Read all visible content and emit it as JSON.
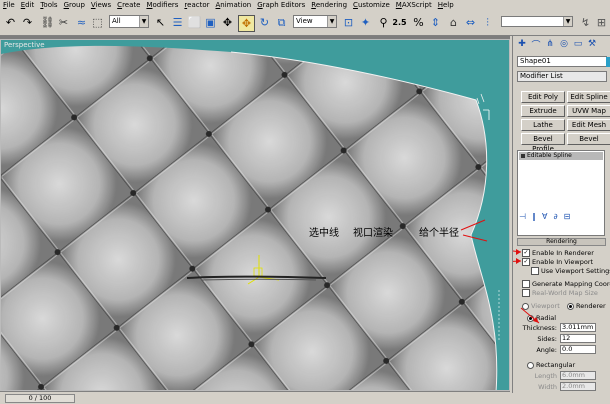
{
  "menu": [
    "File",
    "Edit",
    "Tools",
    "Group",
    "Views",
    "Create",
    "Modifiers",
    "reactor",
    "Animation",
    "Graph Editors",
    "Rendering",
    "Customize",
    "MAXScript",
    "Help"
  ],
  "toolbar": {
    "selection_filter": "All",
    "reference_coord": "View",
    "snap_value": "2.5"
  },
  "viewport": {
    "label": "Perspective",
    "annotations": {
      "a1": "选中线",
      "a2": "视口渲染",
      "a3": "给个半径"
    }
  },
  "panel": {
    "object_name": "Shape01",
    "modifier_list": "Modifier List",
    "buttons": [
      [
        "Edit Poly",
        "Edit Spline"
      ],
      [
        "Extrude",
        "UVW Map"
      ],
      [
        "Lathe",
        "Edit Mesh"
      ],
      [
        "Bevel Profile",
        "Bevel"
      ]
    ],
    "stack_item": "Editable Spline",
    "rendering": {
      "title": "Rendering",
      "enable_in_renderer": "Enable In Renderer",
      "enable_in_viewport": "Enable In Viewport",
      "use_viewport_settings": "Use Viewport Settings",
      "generate_mapping_coords": "Generate Mapping Coords.",
      "real_world_map_size": "Real-World Map Size",
      "viewport_radio": "Viewport",
      "renderer_radio": "Renderer",
      "radial": "Radial",
      "thickness_label": "Thickness:",
      "thickness_value": "3.011mm",
      "sides_label": "Sides:",
      "sides_value": "12",
      "angle_label": "Angle:",
      "angle_value": "0.0",
      "rectangular": "Rectangular",
      "length_label": "Length",
      "length_value": "6.0mm",
      "width_label": "Width",
      "width_value": "2.0mm"
    }
  },
  "status": {
    "time_slider": "0 / 100"
  },
  "colors": {
    "viewport_bg": "#3f9c9c",
    "object_color": "#2aa0c8",
    "annotation_arrow": "#e01010"
  }
}
